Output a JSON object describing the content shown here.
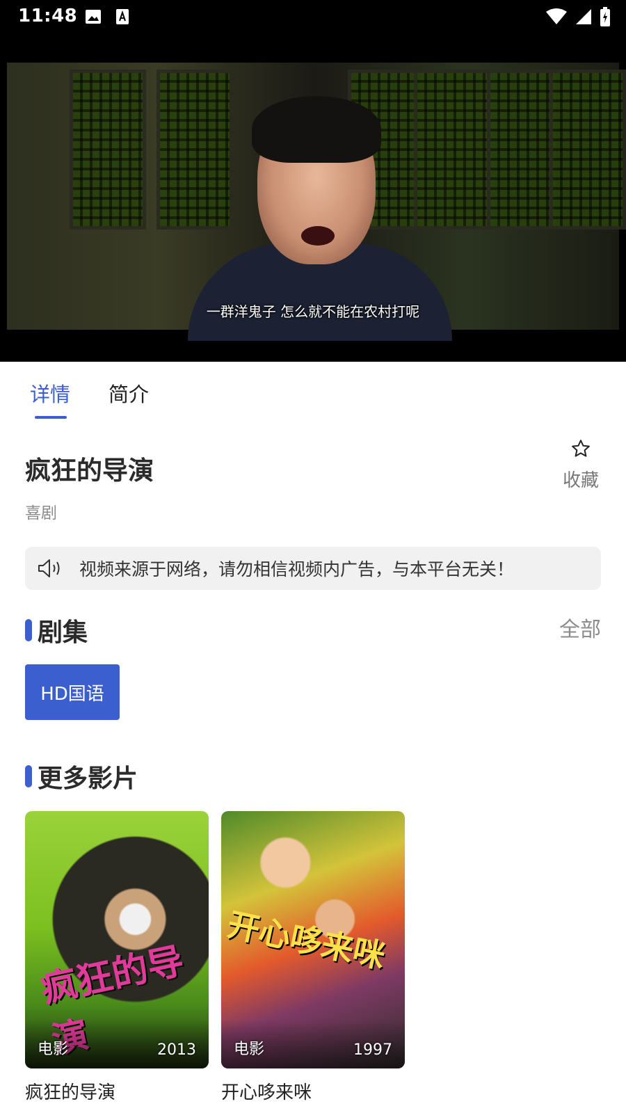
{
  "status_bar": {
    "time": "11:48"
  },
  "video": {
    "subtitle": "一群洋鬼子  怎么就不能在农村打呢"
  },
  "tabs": [
    {
      "label": "详情"
    },
    {
      "label": "简介"
    }
  ],
  "movie": {
    "title": "疯狂的导演",
    "genre": "喜剧",
    "favorite_label": "收藏"
  },
  "notice": {
    "text": "视频来源于网络，请勿相信视频内广告，与本平台无关！"
  },
  "episodes": {
    "title": "剧集",
    "all_label": "全部",
    "items": [
      {
        "label": "HD国语"
      }
    ]
  },
  "more": {
    "title": "更多影片",
    "items": [
      {
        "name": "疯狂的导演",
        "tag": "电影",
        "year": "2013",
        "poster_text": "疯狂的导演"
      },
      {
        "name": "开心哆来咪",
        "tag": "电影",
        "year": "1997",
        "poster_text": "开心哆来咪"
      }
    ]
  },
  "colors": {
    "accent": "#3c5fd0",
    "notice_bg": "#f1f1f1"
  }
}
